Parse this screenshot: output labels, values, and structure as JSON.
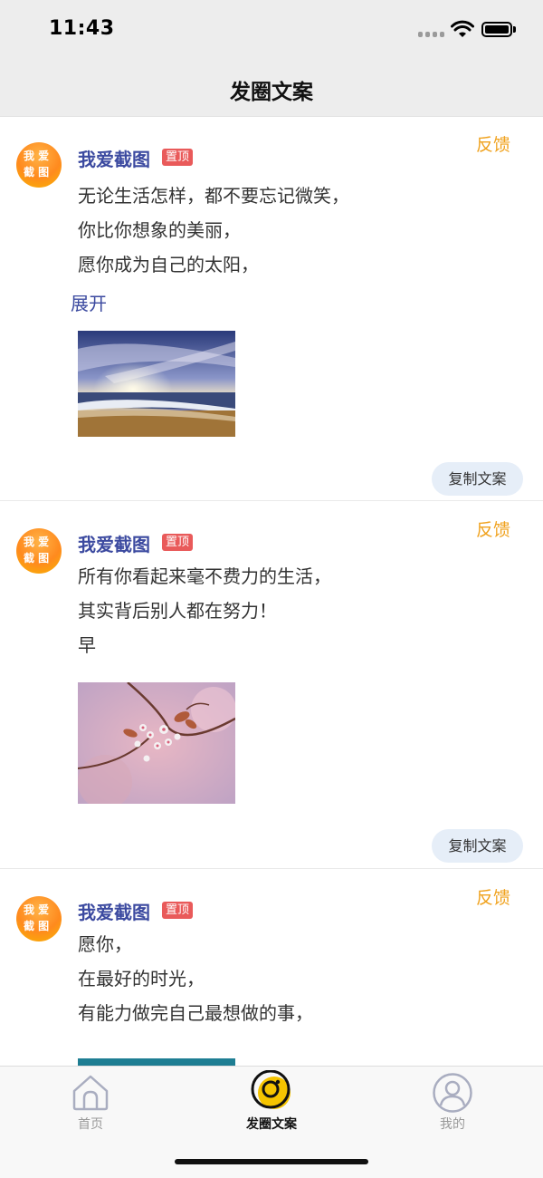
{
  "status_bar": {
    "time": "11:43"
  },
  "header": {
    "title": "发圈文案"
  },
  "avatar": {
    "line1": "我 爱",
    "line2": "截 图"
  },
  "posts": [
    {
      "author": "我爱截图",
      "pin_label": "置顶",
      "feedback_label": "反馈",
      "lines": [
        "无论生活怎样，都不要忘记微笑，",
        "你比你想象的美丽，",
        "愿你成为自己的太阳，"
      ],
      "expand_label": "展开",
      "image": "sunset-beach",
      "copy_label": "复制文案"
    },
    {
      "author": "我爱截图",
      "pin_label": "置顶",
      "feedback_label": "反馈",
      "lines": [
        "所有你看起来毫不费力的生活，",
        "其实背后别人都在努力！",
        "早"
      ],
      "image": "cherry-blossom",
      "copy_label": "复制文案"
    },
    {
      "author": "我爱截图",
      "pin_label": "置顶",
      "feedback_label": "反馈",
      "lines": [
        "愿你，",
        "在最好的时光，",
        "有能力做完自己最想做的事，"
      ],
      "image": "teal-photo"
    }
  ],
  "tabbar": {
    "items": [
      {
        "label": "首页",
        "icon": "home-icon",
        "active": false
      },
      {
        "label": "发圈文案",
        "icon": "circle-icon",
        "active": true
      },
      {
        "label": "我的",
        "icon": "profile-icon",
        "active": false
      }
    ]
  },
  "colors": {
    "accent_blue": "#3c4aa0",
    "feedback_orange": "#f0a21e",
    "pin_red": "#e95a5a",
    "copy_button_bg": "#e6eef8",
    "tab_active_yellow": "#f5c400"
  }
}
